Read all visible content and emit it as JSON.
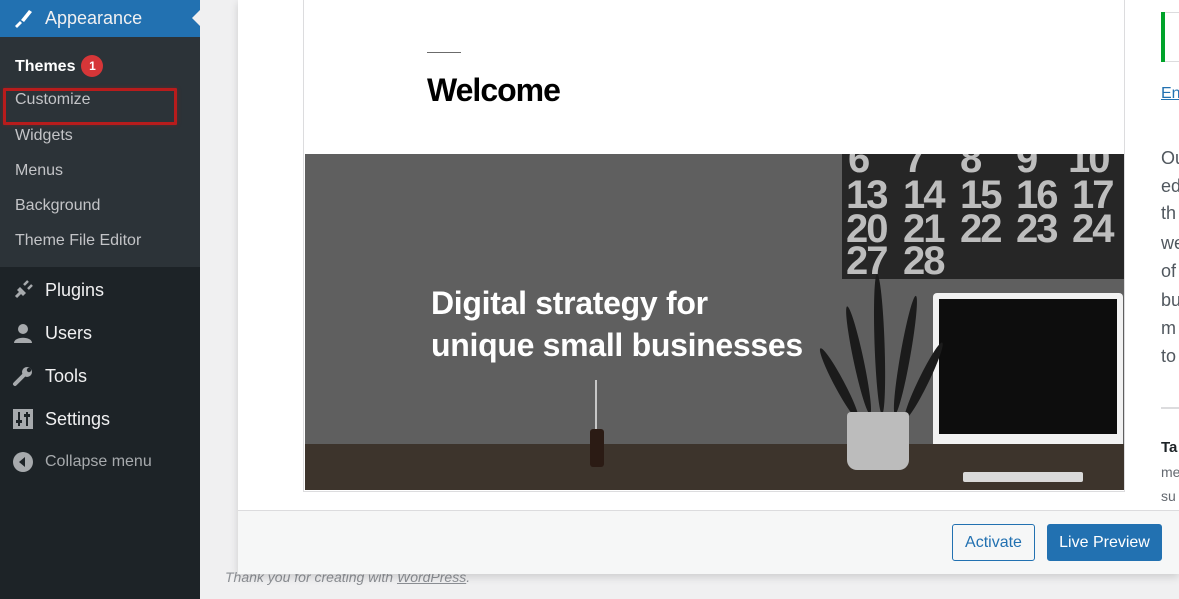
{
  "sidebar": {
    "appearance_label": "Appearance",
    "submenu": {
      "themes_label": "Themes",
      "themes_badge": "1",
      "customize_label": "Customize",
      "widgets_label": "Widgets",
      "menus_label": "Menus",
      "background_label": "Background",
      "theme_file_editor_label": "Theme File Editor"
    },
    "plugins_label": "Plugins",
    "users_label": "Users",
    "tools_label": "Tools",
    "settings_label": "Settings",
    "collapse_label": "Collapse menu"
  },
  "preview": {
    "welcome_title": "Welcome",
    "hero_line1": "Digital strategy for",
    "hero_line2": "unique small businesses",
    "calendar_numbers": [
      "6",
      "7",
      "8",
      "9",
      "10",
      "13",
      "14",
      "15",
      "16",
      "17",
      "20",
      "21",
      "22",
      "23",
      "24",
      "27",
      "28"
    ]
  },
  "details": {
    "link_text": "En",
    "description_lines": [
      "Ou",
      "ed",
      "th",
      "we",
      "of",
      "bu",
      "m",
      "to"
    ],
    "tags_heading": "Ta",
    "tag_lines": [
      "me",
      "su"
    ]
  },
  "actions": {
    "activate_label": "Activate",
    "live_preview_label": "Live Preview"
  },
  "footer": {
    "thank_you_text": "Thank you for creating with ",
    "wordpress_link": "WordPress",
    "period": "."
  },
  "colors": {
    "sidebar_bg": "#1d2327",
    "submenu_bg": "#2c3338",
    "accent_blue": "#2271b1",
    "badge_red": "#d63638",
    "highlight_red": "#b81c1c",
    "success_green": "#00a32a"
  }
}
